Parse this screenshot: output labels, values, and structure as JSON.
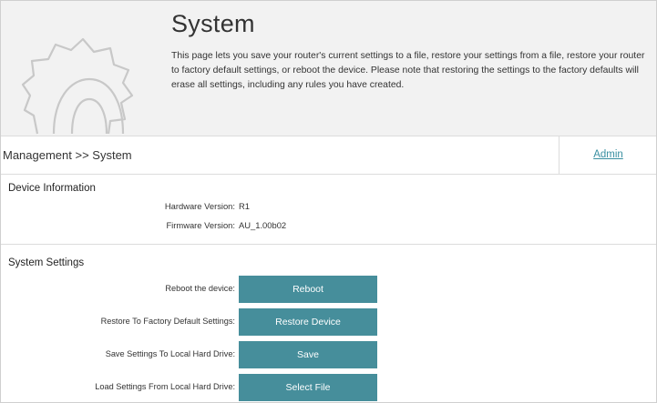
{
  "header": {
    "title": "System",
    "description": "This page lets you save your router's current settings to a file, restore your settings from a file, restore your router to factory default settings, or reboot the device. Please note that restoring the settings to the factory defaults will erase all settings, including any rules you have created."
  },
  "nav": {
    "breadcrumb": "Management >> System",
    "admin_link": "Admin"
  },
  "device_info": {
    "title": "Device Information",
    "hardware_label": "Hardware Version:",
    "hardware_value": "R1",
    "firmware_label": "Firmware Version:",
    "firmware_value": "AU_1.00b02"
  },
  "system_settings": {
    "title": "System Settings",
    "rows": [
      {
        "label": "Reboot the device:",
        "button": "Reboot"
      },
      {
        "label": "Restore To Factory Default Settings:",
        "button": "Restore Device"
      },
      {
        "label": "Save Settings To Local Hard Drive:",
        "button": "Save"
      },
      {
        "label": "Load Settings From Local Hard Drive:",
        "button": "Select File"
      }
    ]
  },
  "colors": {
    "button_bg": "#468e9b",
    "link": "#3a8fa1",
    "header_bg": "#f2f2f2"
  },
  "icons": {
    "header_icon": "gear-icon"
  }
}
